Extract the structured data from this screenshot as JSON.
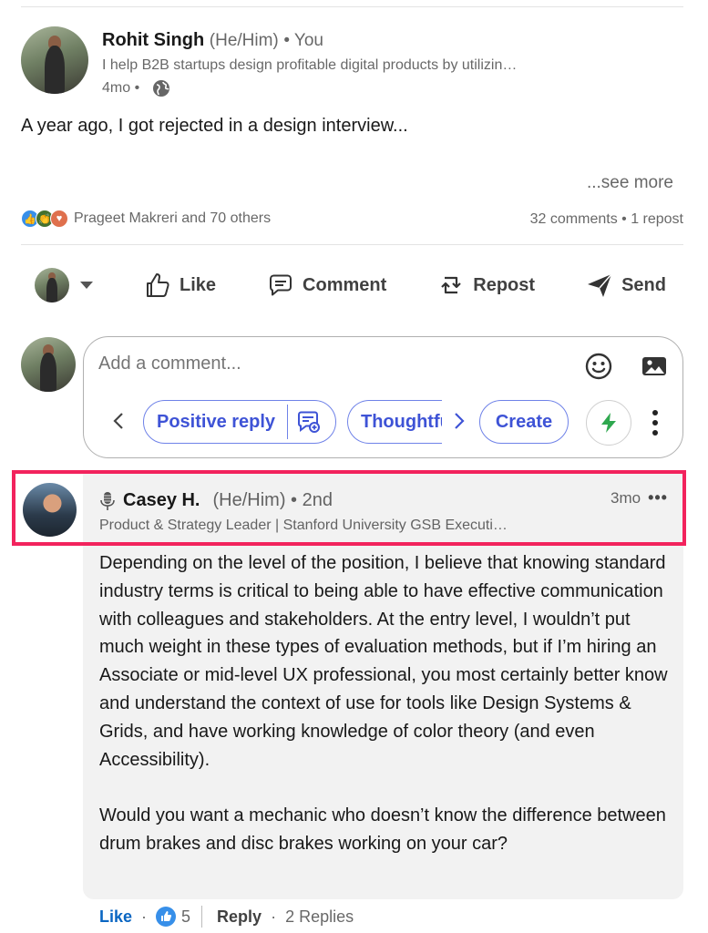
{
  "post": {
    "author_name": "Rohit Singh",
    "author_pronouns": "(He/Him)",
    "author_relation": "• You",
    "author_headline": "I help B2B startups design profitable digital products by utilizin…",
    "time": "4mo •",
    "text": "A year ago, I got rejected in a design interview...",
    "see_more": "...see more",
    "reactions_text": "Prageet Makreri and 70 others",
    "counts_text": "32 comments • 1 repost"
  },
  "actions": {
    "like": "Like",
    "comment": "Comment",
    "repost": "Repost",
    "send": "Send"
  },
  "comment_box": {
    "placeholder": "Add a comment...",
    "suggestion_positive": "Positive reply",
    "suggestion_thoughtful": "Thoughtful",
    "suggestion_create": "Create"
  },
  "comment": {
    "author_name": "Casey H.",
    "author_meta": "(He/Him) • 2nd",
    "time": "3mo",
    "more": "•••",
    "headline": "Product & Strategy Leader | Stanford University GSB Executi…",
    "paragraph1": "Depending on the level of the position, I believe that knowing standard industry terms is critical to being able to have effective communication with colleagues and stakeholders. At the entry level, I wouldn’t put much weight in these types of evaluation methods, but if I’m hiring an Associate or mid-level UX professional, you most certainly better know and understand the context of use for tools like Design Systems & Grids, and have working knowledge of color theory (and even Accessibility).",
    "paragraph2": "Would you want a mechanic who doesn’t know the difference between drum brakes and disc brakes working on your car?",
    "like_label": "Like",
    "separator": "·",
    "like_count": "5",
    "reply_label": "Reply",
    "replies_label": "2 Replies"
  },
  "colors": {
    "highlight": "#f2235d",
    "accent": "#0a66c2",
    "suggestion": "#3e53d6",
    "bolt": "#2fa84f"
  }
}
